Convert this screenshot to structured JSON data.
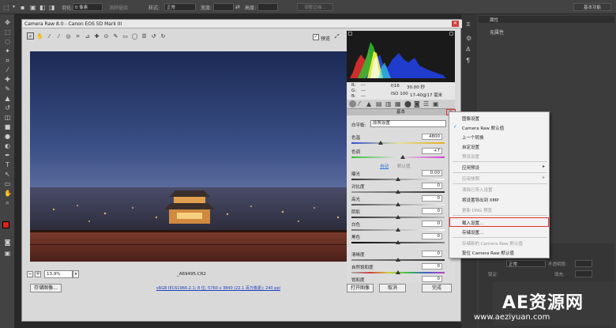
{
  "options_bar": {
    "size_label": "羽化:",
    "size_value": "0 像素",
    "antialias": "消除锯齿",
    "style_label": "样式:",
    "style_value": "正常",
    "width_label": "宽度:",
    "height_label": "高度:",
    "refine_edge": "调整边缘...",
    "workspace": "基本功能"
  },
  "right_panel": {
    "title": "属性",
    "subtitle": "无属性"
  },
  "dialog": {
    "title": "Camera Raw 8.0  -  Canon EOS 5D Mark III",
    "preview_label": "预览",
    "zoom_value": "13.9%",
    "filename": "_A69495.CR2",
    "workflow_link": "sRGB IEC61966-2.1; 8 位; 5760 x 3840 (22.1 百万像素); 240 ppi",
    "save_button": "存储图像...",
    "open_button": "打开图像",
    "cancel_button": "取消",
    "done_button": "完成"
  },
  "camera_info": {
    "r": "R:",
    "g": "G:",
    "b": "B:",
    "dash": "---",
    "aperture": "f/16",
    "shutter": "30.00 秒",
    "iso": "ISO 100",
    "lens": "17-40@17 毫米"
  },
  "basic_panel": {
    "header": "基本",
    "wb_label": "白平衡:",
    "wb_value": "原照设置",
    "temp_label": "色温",
    "temp_value": "4800",
    "tint_label": "色调",
    "tint_value": "+7",
    "auto_label": "自动",
    "default_label": "默认值",
    "sliders": [
      {
        "label": "曝光",
        "value": "0.00"
      },
      {
        "label": "对比度",
        "value": "0"
      },
      {
        "label": "高光",
        "value": "0"
      },
      {
        "label": "阴影",
        "value": "0"
      },
      {
        "label": "白色",
        "value": "0"
      },
      {
        "label": "黑色",
        "value": "0"
      }
    ],
    "sliders2": [
      {
        "label": "清晰度",
        "value": "0"
      },
      {
        "label": "自然饱和度",
        "value": "0"
      },
      {
        "label": "饱和度",
        "value": "0"
      }
    ]
  },
  "menu": {
    "items": [
      {
        "label": "图像设置",
        "disabled": false
      },
      {
        "label": "Camera Raw 默认值",
        "disabled": false,
        "checked": true
      },
      {
        "label": "上一个转换",
        "disabled": false
      },
      {
        "label": "自定设置",
        "disabled": false
      },
      {
        "label": "预设设置",
        "disabled": true
      },
      {
        "label": "应用预设",
        "disabled": false,
        "submenu": true
      },
      {
        "label": "应用快照",
        "disabled": true,
        "submenu": true
      },
      {
        "label": "清除已导入设置",
        "disabled": true
      },
      {
        "label": "将设置导出到 XMP",
        "disabled": false
      },
      {
        "label": "更新 DNG 预览",
        "disabled": true
      },
      {
        "label": "载入设置...",
        "disabled": false,
        "highlighted": true
      },
      {
        "label": "存储设置...",
        "disabled": false
      },
      {
        "label": "存储新的 Camera Raw 默认值",
        "disabled": true
      },
      {
        "label": "复位 Camera Raw 默认值",
        "disabled": false
      }
    ]
  },
  "layers": {
    "mode": "正常",
    "opacity_label": "不透明度:",
    "lock_label": "锁定:",
    "fill_label": "填充:"
  },
  "watermark": {
    "brand": "AE资源网",
    "url": "www.aeziyuan.com"
  },
  "colors": {
    "accent_red": "#e03030",
    "check_blue": "#2b6fd6"
  }
}
